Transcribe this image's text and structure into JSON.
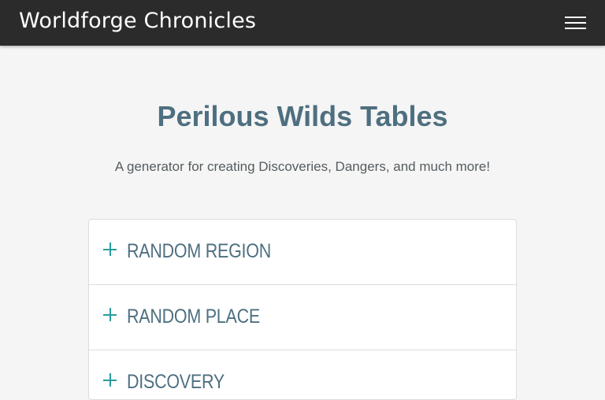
{
  "navbar": {
    "brand": "Worldforge Chronicles",
    "menu_icon": "hamburger-menu-icon"
  },
  "hero": {
    "title": "Perilous Wilds Tables",
    "subtitle": "A generator for creating Discoveries, Dangers, and much more!"
  },
  "accordion": {
    "items": [
      {
        "label": "RANDOM REGION",
        "icon": "plus-icon"
      },
      {
        "label": "RANDOM PLACE",
        "icon": "plus-icon"
      },
      {
        "label": "DISCOVERY",
        "icon": "plus-icon"
      }
    ]
  },
  "colors": {
    "navbar_bg": "#2b2b2b",
    "page_bg": "#f5f5f5",
    "title": "#4e6f80",
    "accent_plus": "#2a9d9d"
  }
}
